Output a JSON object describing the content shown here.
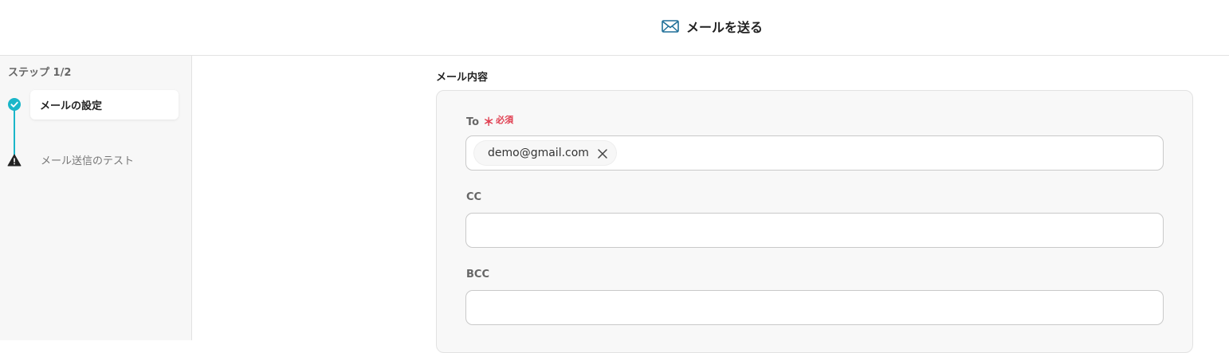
{
  "header": {
    "icon": "mail-icon",
    "title": "メールを送る"
  },
  "sidebar": {
    "step_label": "ステップ 1/2",
    "steps": [
      {
        "label": "メールの設定",
        "status": "completed",
        "icon": "check-circle-icon"
      },
      {
        "label": "メール送信のテスト",
        "status": "warning",
        "icon": "warning-icon"
      }
    ]
  },
  "main": {
    "section_title": "メール内容",
    "fields": {
      "to": {
        "label": "To",
        "asterisk": "＊",
        "required_badge": "必須",
        "chips": [
          {
            "value": "demo@gmail.com"
          }
        ]
      },
      "cc": {
        "label": "CC",
        "value": ""
      },
      "bcc": {
        "label": "BCC",
        "value": ""
      }
    }
  },
  "colors": {
    "accent": "#1ab6c9",
    "required": "#e03d4f",
    "mail_icon": "#1e6f98"
  }
}
